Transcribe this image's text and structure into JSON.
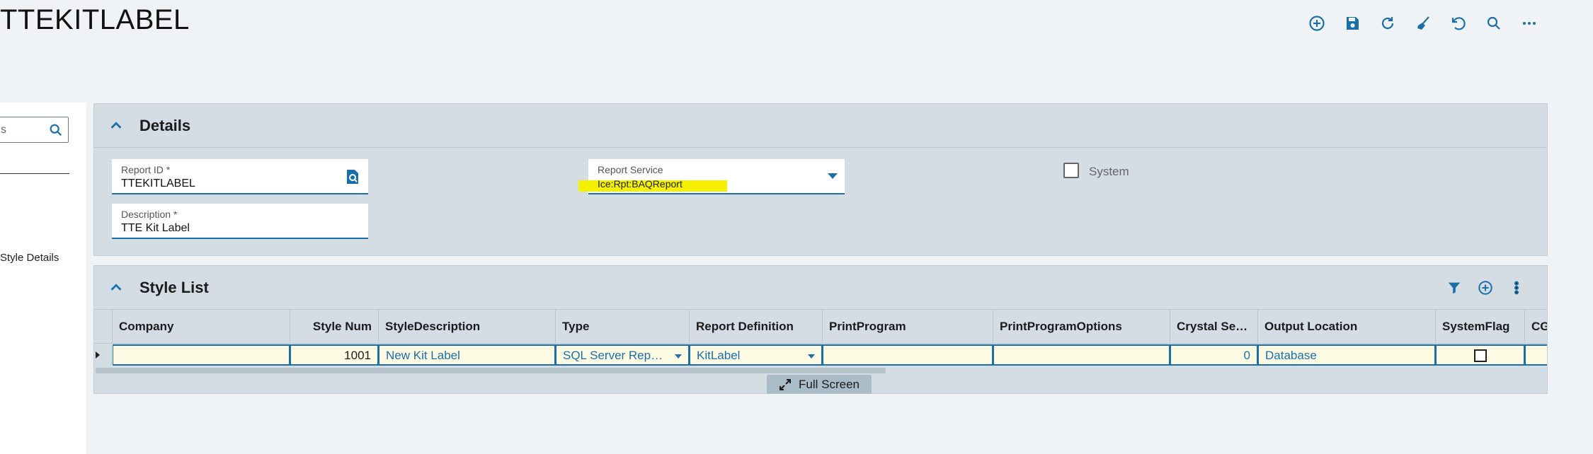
{
  "page": {
    "title": "TTEKITLABEL"
  },
  "toolbar": {
    "icons": [
      "add-new-icon",
      "save-icon",
      "refresh-icon",
      "clear-icon",
      "undo-icon",
      "search-icon",
      "more-icon"
    ]
  },
  "nav": {
    "search_text": "s",
    "item_label": "Style Details"
  },
  "details": {
    "title": "Details",
    "report_id": {
      "label": "Report ID *",
      "value": "TTEKITLABEL"
    },
    "description": {
      "label": "Description *",
      "value": "TTE Kit Label"
    },
    "report_service": {
      "label": "Report Service",
      "value": "Ice:Rpt:BAQReport"
    },
    "system": {
      "label": "System",
      "checked": false
    }
  },
  "style_list": {
    "title": "Style List",
    "columns": [
      "Company",
      "Style Num",
      "StyleDescription",
      "Type",
      "Report Definition",
      "PrintProgram",
      "PrintProgramOptions",
      "Crystal Se…",
      "Output Location",
      "SystemFlag",
      "CGC"
    ],
    "row": {
      "company": "",
      "style_num": "1001",
      "style_description": "New Kit Label",
      "type": "SQL Server Rep…",
      "report_definition": "KitLabel",
      "print_program": "",
      "print_program_options": "",
      "crystal_se": "0",
      "output_location": "Database",
      "system_flag": false,
      "cgc": ""
    },
    "full_screen_label": "Full Screen"
  },
  "colors": {
    "accent": "#1b6fa8",
    "panel": "#d3dde3",
    "highlight": "#f5f000",
    "row": "#fbf9dd"
  }
}
